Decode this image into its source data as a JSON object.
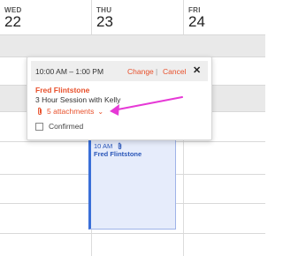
{
  "days": [
    {
      "name": "WED",
      "number": "22"
    },
    {
      "name": "THU",
      "number": "23"
    },
    {
      "name": "FRI",
      "number": "24"
    }
  ],
  "popup": {
    "time_range": "10:00 AM – 1:00 PM",
    "change_label": "Change",
    "separator": "|",
    "cancel_label": "Cancel",
    "close_label": "✕",
    "client_name": "Fred Flintstone",
    "session_title": "3 Hour Session with Kelly",
    "attachments_label": "5 attachments",
    "attachments_chevron": "⌄",
    "confirmed_label": "Confirmed",
    "confirmed_checked": false
  },
  "event": {
    "time": "10 AM",
    "client_name": "Fred Flintstone",
    "icon": "paperclip-icon"
  },
  "colors": {
    "accent": "#e8502b",
    "event_bg": "#e6ecfb",
    "event_border": "#3a6fd8",
    "arrow": "#e639d6"
  }
}
